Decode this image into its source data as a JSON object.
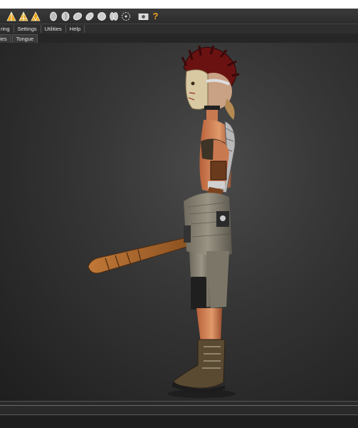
{
  "menu": {
    "items": [
      "ring",
      "Settings",
      "Utilities",
      "Help"
    ]
  },
  "tabs": [
    "ies",
    "Tongue"
  ],
  "toolbar": {
    "icons": [
      "pyramid-warning-icon",
      "pyramid-warning-icon",
      "pyramid-warning-icon",
      "head-front-icon",
      "head-side-icon",
      "head-tilt-icon",
      "head-rotate-icon",
      "sphere-icon",
      "twin-heads-icon",
      "orbit-icon",
      "camera-icon",
      "help-question-icon"
    ],
    "help_symbol": "?"
  },
  "colors": {
    "accent_orange": "#f0a020",
    "toolbar_bg": "#333333",
    "viewport_bg": "#2e2e2e"
  }
}
